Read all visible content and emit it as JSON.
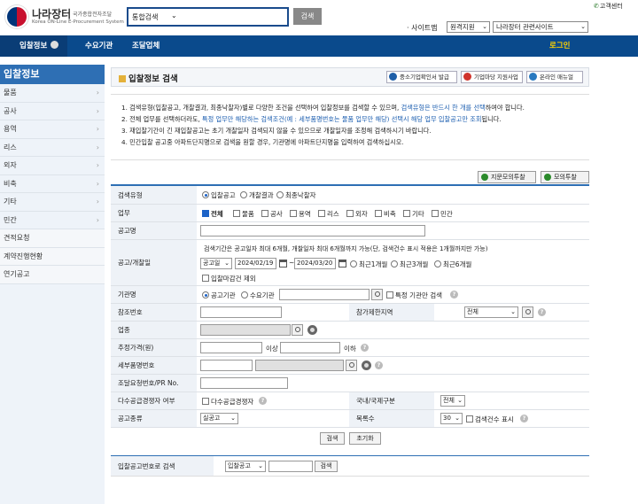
{
  "header": {
    "logo_title": "나라장터",
    "logo_small": "국가종합전자조달",
    "logo_english": "Korea ON-Line E-Procurement System",
    "search_select": "통합검색",
    "search_button": "검색",
    "customer_center": "고객센터",
    "sitemap": "· 사이트맵",
    "remote_support": "원격지원",
    "related_sites": "나라장터 관련사이트"
  },
  "nav": {
    "items": [
      "입찰정보",
      "수요기관",
      "조달업체"
    ],
    "login": "로그인"
  },
  "sidebar": {
    "title": "입찰정보",
    "items": [
      "물품",
      "공사",
      "용역",
      "리스",
      "외자",
      "비축",
      "기타",
      "민간"
    ],
    "plain_items": [
      "견적요청",
      "계약진행현황",
      "연기공고"
    ]
  },
  "content": {
    "title": "입찰정보 검색",
    "header_buttons": [
      "중소기업확인서 발급",
      "기업마당 지원사업",
      "온라인 매뉴얼"
    ],
    "notices": [
      {
        "pre": "1. 검색유형(입찰공고, 개찰결과, 최종낙찰자)별로 다양한 조건을 선택하여 입찰정보를 검색할 수 있으며, ",
        "hl": "검색유형은 반드시 한 개를 선택",
        "post": "하여야 합니다."
      },
      {
        "pre": "2. 전체 업무를 선택하더라도, ",
        "hl": "특정 업무만 해당하는 검색조건(예 : 세부품명번호는 물품 업무만 해당) 선택시 해당 업무 입찰공고만 조회",
        "post": "됩니다."
      },
      {
        "pre": "3. 재입찰기간이 긴 재입찰공고는 초기 개찰일자 검색되지 않을 수 있으므로 개찰일자를 조정해 검색하시기 바랍니다.",
        "hl": "",
        "post": ""
      },
      {
        "pre": "4. 민간입찰 공고중 아파트단지명으로 검색을 원할 경우, 기관명에 아파트단지명을 입력하여 검색하십시오.",
        "hl": "",
        "post": ""
      }
    ],
    "top_buttons": [
      "지문모의투찰",
      "모의투찰"
    ]
  },
  "form": {
    "search_type_label": "검색유형",
    "search_types": [
      "입찰공고",
      "개찰결과",
      "최종낙찰자"
    ],
    "biz_label": "업무",
    "biz_options": [
      "전체",
      "물품",
      "공사",
      "용역",
      "리스",
      "외자",
      "비축",
      "기타",
      "민간"
    ],
    "notice_name_label": "공고명",
    "date_label": "공고/개찰일",
    "date_note": "검색기간은 공고일자 최대 6개월, 개찰일자 최대 6개월까지 가능(단, 검색건수 표시 적용은 1개월까지만 가능)",
    "date_type": "공고일",
    "date_from": "2024/02/19",
    "date_to": "2024/03/20",
    "period_options": [
      "최근1개월",
      "최근3개월",
      "최근6개월"
    ],
    "exclude_closed": "입찰마감건 제외",
    "agency_label": "기관명",
    "agency_options": [
      "공고기관",
      "수요기관"
    ],
    "specific_agency": "특정 기관만 검색",
    "ref_no_label": "참조번호",
    "region_label": "참가제한지역",
    "region_value": "전체",
    "industry_label": "업종",
    "price_label": "추정가격(원)",
    "price_above": "이상",
    "price_below": "이하",
    "detail_item_label": "세부품명번호",
    "pr_label": "조달요청번호/PR No.",
    "multi_label": "다수공급경쟁자 여부",
    "multi_option": "다수공급경쟁자",
    "intl_label": "국내/국제구분",
    "intl_value": "전체",
    "kind_label": "공고종류",
    "kind_value": "실공고",
    "count_label": "목록수",
    "count_value": "30",
    "count_display": "검색건수 표시",
    "search_button": "검색",
    "reset_button": "초기화"
  },
  "bottom": {
    "label": "입찰공고번호로 검색",
    "select": "입찰공고",
    "button": "검색"
  }
}
